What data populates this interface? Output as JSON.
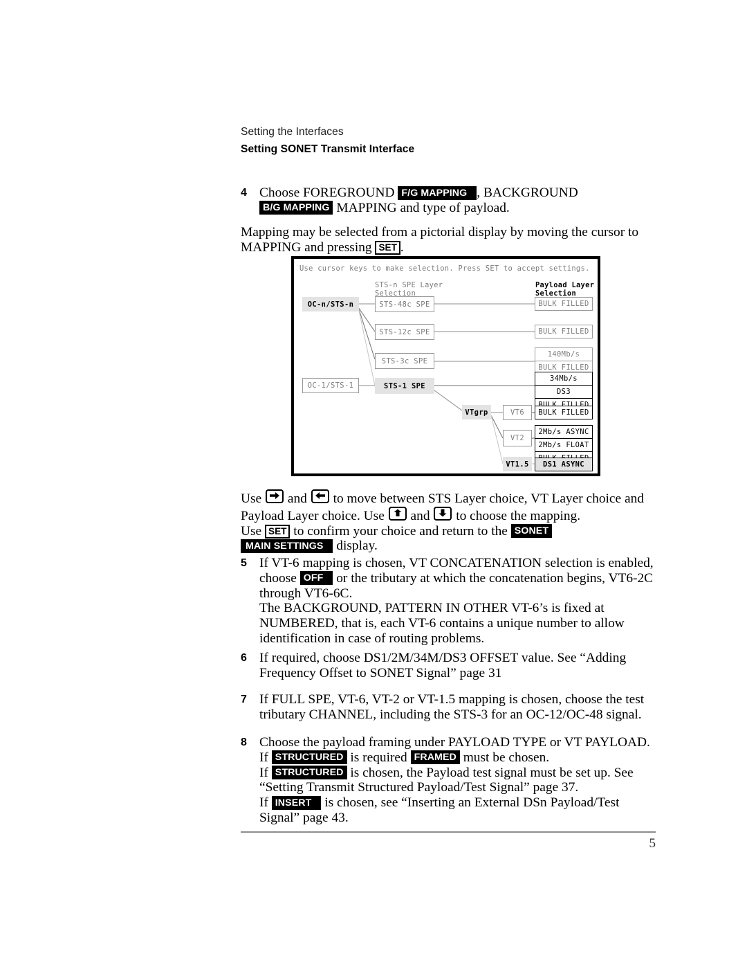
{
  "header": {
    "running_head": "Setting the Interfaces",
    "section_title": "Setting SONET Transmit Interface"
  },
  "steps": {
    "step4": {
      "number": "4",
      "t1": "Choose FOREGROUND ",
      "key_fg": "F/G MAPPING",
      "t2": ", BACKGROUND ",
      "key_bg": "B/G MAPPING",
      "t3": " MAPPING and type of payload."
    },
    "para_mapping": {
      "t1": "Mapping may be selected from a pictorial display by moving the cursor to MAPPING and pressing ",
      "key_set": "SET",
      "t2": "."
    },
    "para_use": {
      "t1": "Use ",
      "arrow_right": "arrow-right",
      "t2": " and ",
      "arrow_left": "arrow-left",
      "t3": " to move between STS Layer choice, VT Layer choice and Payload Layer choice. Use ",
      "arrow_up": "arrow-up",
      "t4": " and ",
      "arrow_down": "arrow-down",
      "t5": " to choose the mapping.",
      "t6": "Use ",
      "key_set": "SET",
      "t7": " to confirm your choice and return to the ",
      "key_sonet": "SONET",
      "key_main_settings": "MAIN SETTINGS",
      "t8": " display."
    },
    "step5": {
      "number": "5",
      "t1": "If VT-6 mapping is chosen, VT CONCATENATION selection is enabled, choose ",
      "key_off": "OFF",
      "t2": " or the tributary at which the concatenation begins, VT6-2C through VT6-6C.",
      "t3": "The BACKGROUND, PATTERN IN OTHER VT-6’s is fixed at NUMBERED, that is, each VT-6 contains a unique number to allow identification in case of routing problems."
    },
    "step6": {
      "number": "6",
      "t1": "If required, choose DS1/2M/34M/DS3 OFFSET value. See “Adding Frequency Offset to SONET Signal”  page 31"
    },
    "step7": {
      "number": "7",
      "t1": "If FULL SPE, VT-6, VT-2 or VT-1.5 mapping is chosen, choose the test tributary CHANNEL, including the STS-3 for an OC-12/OC-48 signal."
    },
    "step8": {
      "number": "8",
      "t1": "Choose the payload framing under PAYLOAD TYPE or VT PAYLOAD.",
      "t2": "If ",
      "key_structured_a": "STRUCTURED",
      "t3": " is required ",
      "key_framed": "FRAMED",
      "t4": " must be chosen.",
      "t5": "If ",
      "key_structured_b": "STRUCTURED",
      "t6": " is chosen, the Payload test signal must be set up. See “Setting Transmit Structured Payload/Test Signal”  page 37.",
      "t7": "If ",
      "key_insert": "INSERT",
      "t8": " is chosen, see “Inserting an External DSn Payload/Test Signal”  page 43."
    }
  },
  "lcd": {
    "prompt": "Use cursor keys to make selection. Press SET to accept settings.",
    "col_sts_label_l1": "STS-n SPE Layer",
    "col_sts_label_l2": "Selection",
    "col_payload_label_l1": "Payload Layer",
    "col_payload_label_l2": "Selection",
    "interface_nodes": [
      {
        "label": "OC-n/STS-n",
        "selected": true
      },
      {
        "label": "OC-1/STS-1",
        "selected": false
      }
    ],
    "spe_nodes": [
      {
        "label": "STS-48c SPE",
        "selected": false
      },
      {
        "label": "STS-12c SPE",
        "selected": false
      },
      {
        "label": "STS-3c SPE",
        "selected": false
      },
      {
        "label": "STS-1 SPE",
        "selected": true
      }
    ],
    "vt_nodes": [
      {
        "label": "VTgrp",
        "selected": true
      },
      {
        "label": "VT6",
        "selected": false
      },
      {
        "label": "VT2",
        "selected": false
      },
      {
        "label": "VT1.5",
        "selected": true
      }
    ],
    "payload_groups": [
      {
        "items": [
          "BULK FILLED"
        ],
        "emphasis": "gray"
      },
      {
        "items": [
          "BULK FILLED"
        ],
        "emphasis": "gray"
      },
      {
        "items": [
          "140Mb/s",
          "BULK FILLED"
        ],
        "emphasis": "gray"
      },
      {
        "items": [
          "34Mb/s",
          "DS3",
          "BULK FILLED"
        ],
        "emphasis": "dark"
      },
      {
        "items": [
          "BULK FILLED"
        ],
        "emphasis": "dark"
      },
      {
        "items": [
          "2Mb/s ASYNC",
          "2Mb/s FLOAT",
          "BULK FILLED"
        ],
        "emphasis": "dark"
      },
      {
        "items": [
          "DS1 ASYNC"
        ],
        "emphasis": "selected"
      }
    ]
  },
  "footer": {
    "page_number": "5"
  },
  "colors": {
    "lcd_text_dim": "#7b7b7b",
    "lcd_text_dark": "#000000",
    "lcd_highlight": "#e3e3e3",
    "key_block_bg": "#000000"
  }
}
